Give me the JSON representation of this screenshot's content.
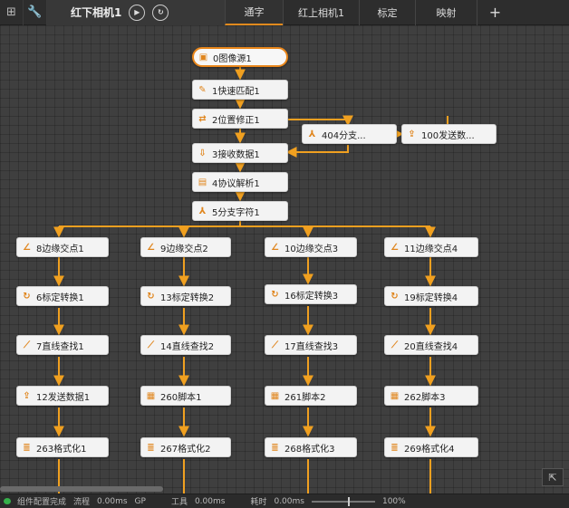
{
  "topbar": {
    "grid_icon": "grid-icon",
    "wrench_icon": "wrench-icon",
    "active_tab": "红下相机1",
    "run_once_icon": "play-circle-icon",
    "run_loop_icon": "loop-play-icon",
    "tabs": [
      "通字",
      "红上相机1",
      "标定",
      "映射"
    ],
    "add_icon": "+"
  },
  "nodes": {
    "n0": "0图像源1",
    "n1": "1快速匹配1",
    "n2": "2位置修正1",
    "n404": "404分支...",
    "n100": "100发送数...",
    "n3": "3接收数据1",
    "n4": "4协议解析1",
    "n5": "5分支字符1",
    "c1": [
      "8边缘交点1",
      "6标定转换1",
      "7直线查找1",
      "12发送数据1",
      "263格式化1"
    ],
    "c2": [
      "9边缘交点2",
      "13标定转换2",
      "14直线查找2",
      "260脚本1",
      "267格式化2"
    ],
    "c3": [
      "10边缘交点3",
      "16标定转换3",
      "17直线查找3",
      "261脚本2",
      "268格式化3"
    ],
    "c4": [
      "11边缘交点4",
      "19标定转换4",
      "20直线查找4",
      "262脚本3",
      "269格式化4"
    ]
  },
  "status": {
    "config_label": "组件配置完成",
    "flow_label": "流程",
    "flow_time": "0.00ms",
    "gp": "GP",
    "tool_label": "工具",
    "tool_time": "0.00ms",
    "total_label": "耗时",
    "total_time": "0.00ms",
    "zoom": "100%"
  },
  "colors": {
    "accent": "#e8861b",
    "link": "#f0a020"
  }
}
